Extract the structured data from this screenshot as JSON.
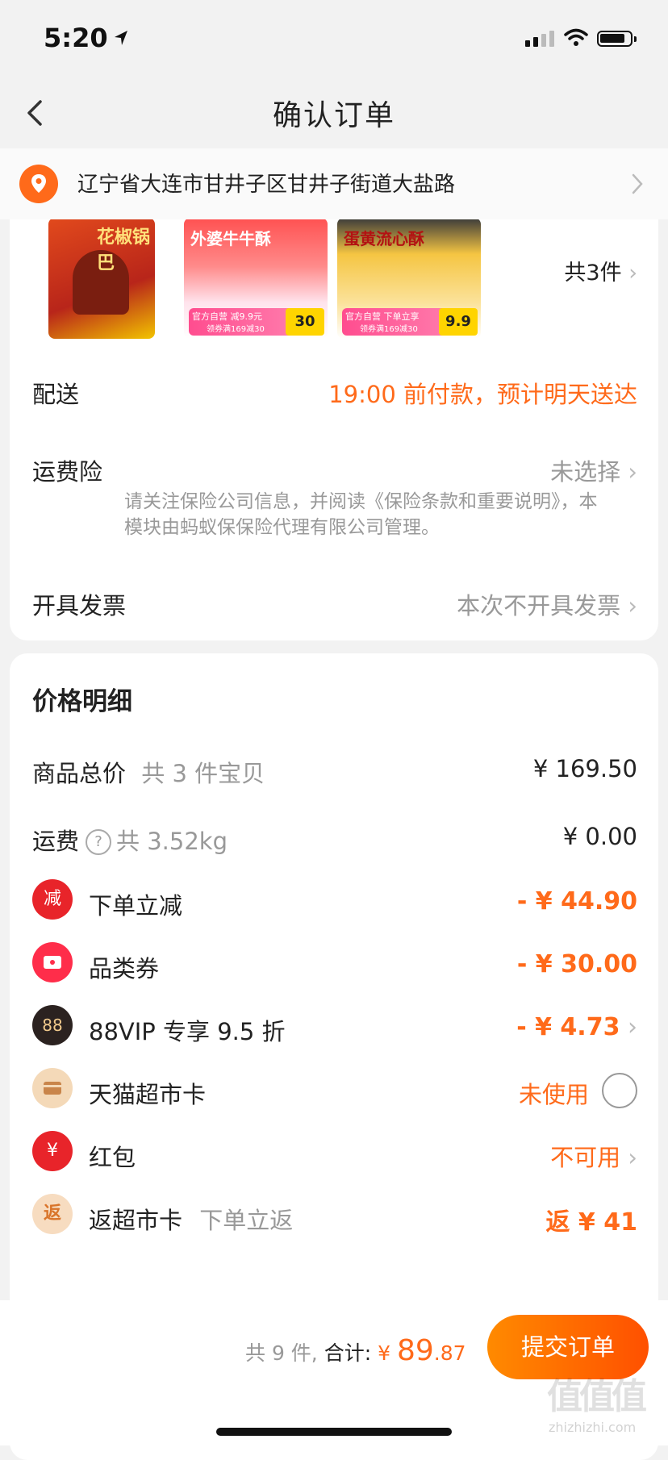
{
  "status_bar": {
    "time": "5:20"
  },
  "header": {
    "title": "确认订单"
  },
  "address": {
    "text": "辽宁省大连市甘井子区甘井子街道大盐路"
  },
  "products": {
    "count_label": "共3件",
    "items": [
      {
        "name": "花椒锅巴"
      },
      {
        "name": "外婆牛牛酥",
        "tag": "官方自营 减9.9元",
        "coupon": "领券满169减30",
        "price": "30"
      },
      {
        "name": "蛋黄流心酥",
        "tag": "官方自营 下单立享",
        "coupon": "领券满169减30",
        "price": "9.9"
      }
    ]
  },
  "delivery": {
    "label": "配送",
    "value": "19:00 前付款，预计明天送达"
  },
  "insurance": {
    "label": "运费险",
    "value": "未选择",
    "note": "请关注保险公司信息，并阅读《保险条款和重要说明》，本模块由蚂蚁保保险代理有限公司管理。"
  },
  "invoice": {
    "label": "开具发票",
    "value": "本次不开具发票"
  },
  "price_detail": {
    "title": "价格明细",
    "goods_total": {
      "label": "商品总价",
      "sub": "共 3 件宝贝",
      "value": "¥ 169.50"
    },
    "shipping": {
      "label": "运费",
      "sub": "共 3.52kg",
      "value": "¥ 0.00"
    },
    "order_discount": {
      "icon": "减",
      "label": "下单立减",
      "value": "- ¥ 44.90"
    },
    "category_coupon": {
      "label": "品类券",
      "value": "- ¥ 30.00"
    },
    "vip": {
      "icon": "88",
      "label": "88VIP 专享 9.5 折",
      "value": "- ¥ 4.73"
    },
    "market_card": {
      "label": "天猫超市卡",
      "value": "未使用"
    },
    "red_packet": {
      "icon": "¥",
      "label": "红包",
      "value": "不可用"
    },
    "return_card": {
      "icon": "返",
      "label": "返超市卡",
      "sub": "下单立返",
      "value": "返 ¥ 41"
    }
  },
  "footer": {
    "items": "共 9 件,",
    "total_label": "合计:",
    "currency": "¥",
    "total_int": "89",
    "total_dec": ".87",
    "submit": "提交订单"
  },
  "watermark": {
    "main": "值值值",
    "sub": "zhizhizhi.com"
  },
  "colors": {
    "accent": "#ff6a1a",
    "button": "#ff5000",
    "coupon_pink": "#ff4d8f"
  }
}
